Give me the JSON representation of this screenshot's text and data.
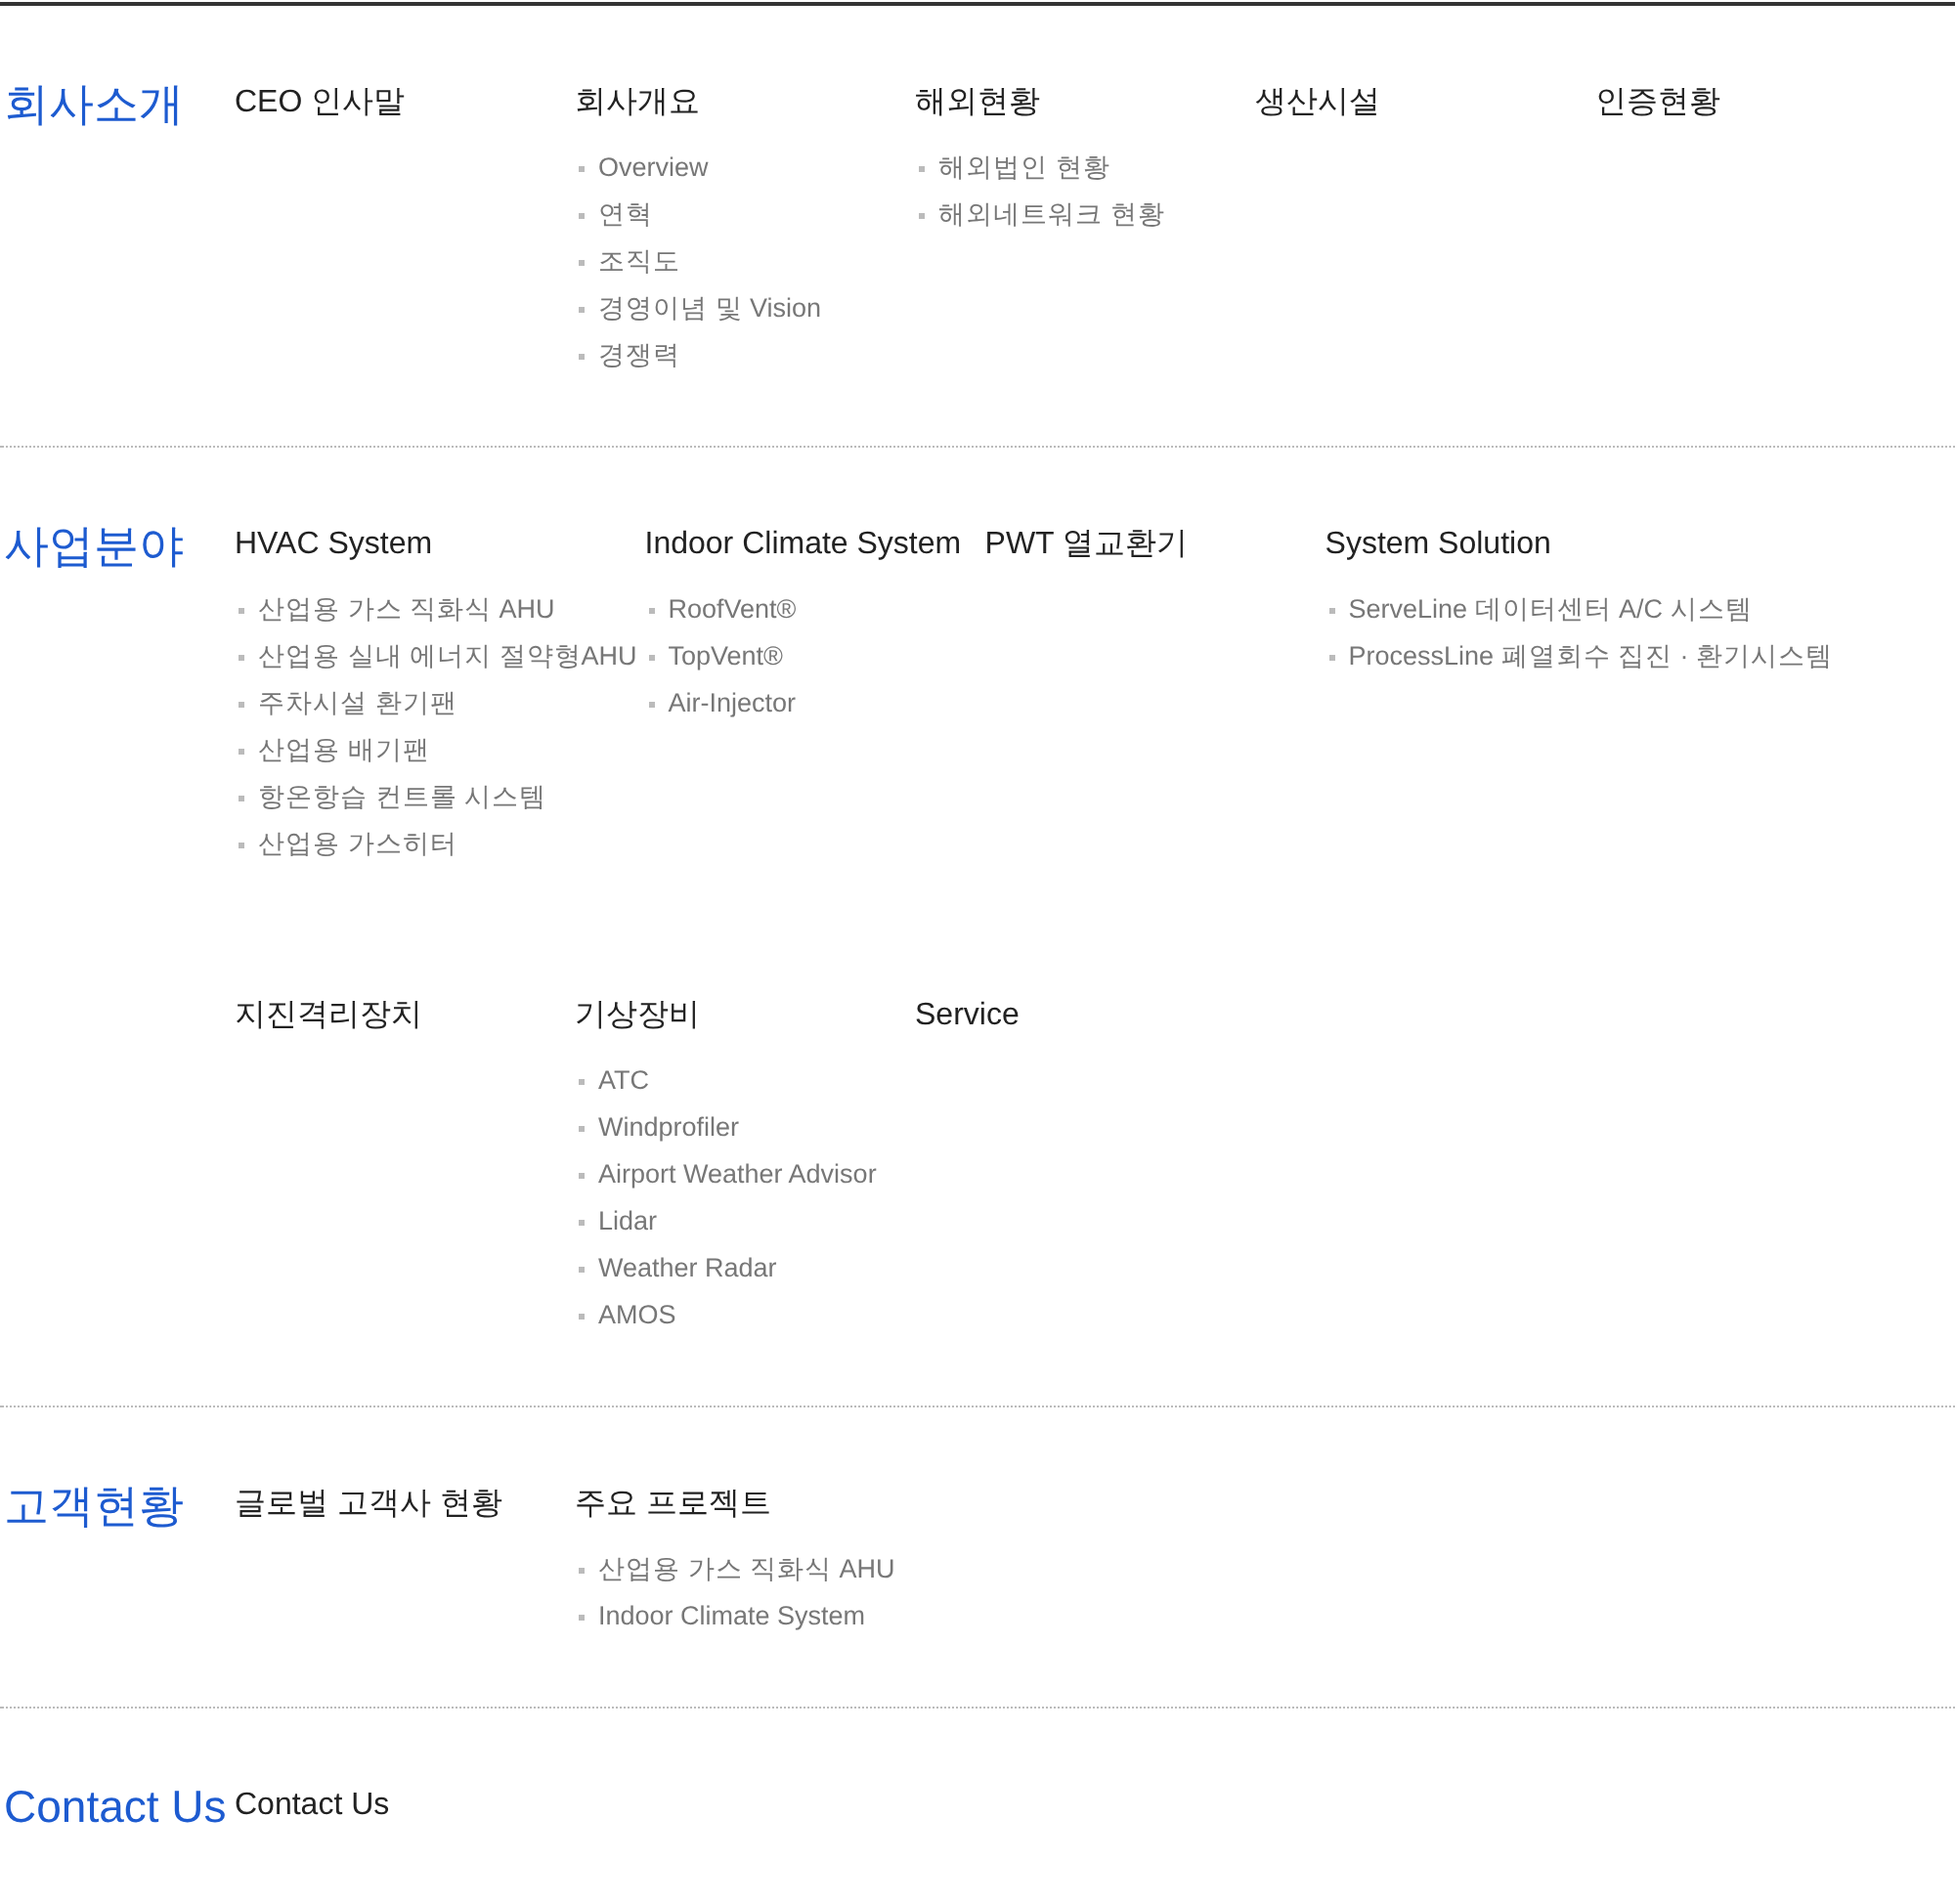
{
  "sections": [
    {
      "title": "회사소개",
      "rows": [
        [
          {
            "title": "CEO 인사말"
          },
          {
            "title": "회사개요",
            "items": [
              "Overview",
              "연혁",
              "조직도",
              "경영이념 및 Vision",
              "경쟁력"
            ]
          },
          {
            "title": "해외현황",
            "items": [
              "해외법인 현황",
              "해외네트워크 현황"
            ]
          },
          {
            "title": "생산시설"
          },
          {
            "title": "인증현황"
          }
        ]
      ]
    },
    {
      "title": "사업분야",
      "rows": [
        [
          {
            "title": "HVAC System",
            "items": [
              "산업용 가스 직화식 AHU",
              "산업용 실내 에너지 절약형AHU",
              "주차시설 환기팬",
              "산업용 배기팬",
              "항온항습 컨트롤 시스템",
              "산업용 가스히터"
            ]
          },
          {
            "title": "Indoor Climate System",
            "items": [
              "RoofVent®",
              "TopVent®",
              "Air-Injector"
            ]
          },
          {
            "title": "PWT 열교환기"
          },
          {
            "title": "System Solution",
            "items": [
              "ServeLine 데이터센터 A/C 시스템",
              "ProcessLine 폐열회수 집진 · 환기시스템"
            ]
          }
        ],
        [
          {
            "title": "지진격리장치"
          },
          {
            "title": "기상장비",
            "items": [
              "ATC",
              "Windprofiler",
              "Airport Weather Advisor",
              "Lidar",
              "Weather Radar",
              "AMOS"
            ]
          },
          {
            "title": "Service"
          }
        ]
      ]
    },
    {
      "title": "고객현황",
      "rows": [
        [
          {
            "title": "글로벌 고객사 현황"
          },
          {
            "title": "주요 프로젝트",
            "items": [
              "산업용 가스 직화식 AHU",
              "Indoor Climate System"
            ]
          }
        ]
      ]
    },
    {
      "title": "Contact Us",
      "rows": [
        [
          {
            "title": "Contact Us"
          }
        ]
      ]
    }
  ]
}
